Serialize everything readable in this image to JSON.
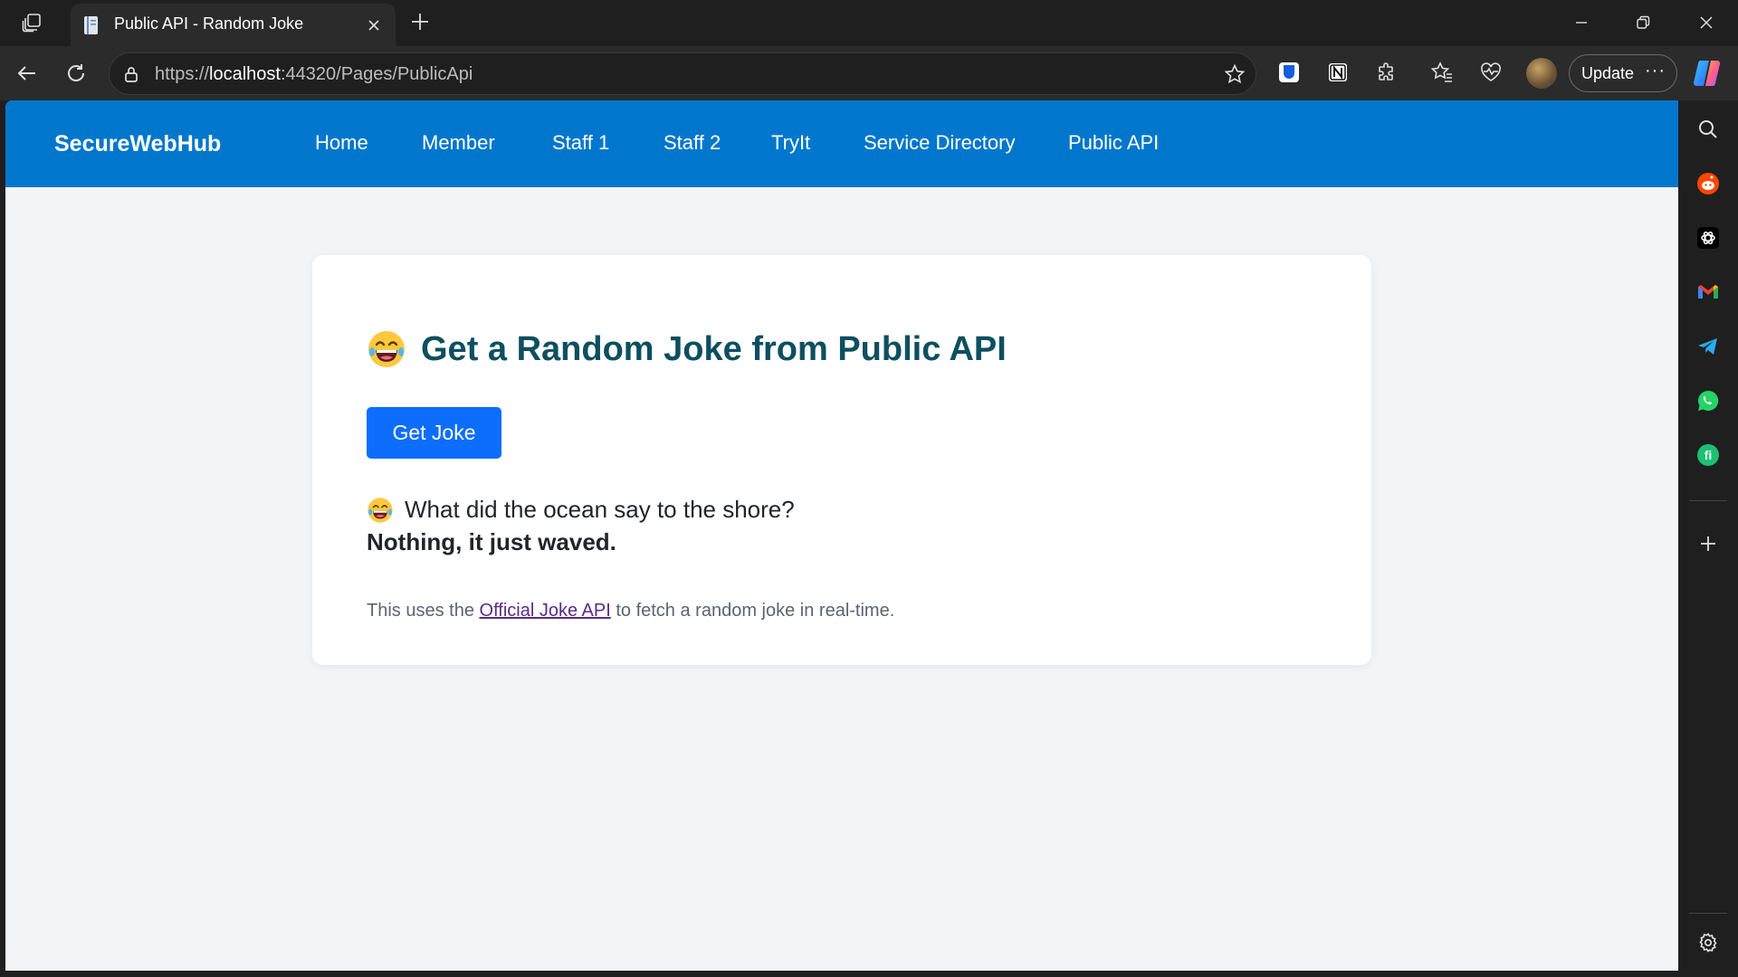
{
  "browser": {
    "tab": {
      "title": "Public API - Random Joke"
    },
    "address": {
      "scheme": "https://",
      "host": "localhost",
      "rest": ":44320/Pages/PublicApi"
    },
    "update_label": "Update",
    "more_label": "···"
  },
  "navbar": {
    "brand": "SecureWebHub",
    "links": [
      "Home",
      "Member",
      "Staff 1",
      "Staff 2",
      "TryIt",
      "Service Directory",
      "Public API"
    ]
  },
  "card": {
    "heading": "Get a Random Joke from Public API",
    "button_label": "Get Joke",
    "joke_setup": "What did the ocean say to the shore?",
    "joke_punchline": "Nothing, it just waved.",
    "footnote_before": "This uses the ",
    "footnote_link": "Official Joke API",
    "footnote_after": " to fetch a random joke in real-time."
  },
  "colors": {
    "navbar": "#0077cc",
    "heading": "#0d4f60",
    "button": "#0d6efd",
    "page_bg": "#f3f4f6"
  },
  "icons": {
    "sidebar": [
      "search-icon",
      "reddit-icon",
      "chatgpt-icon",
      "gmail-icon",
      "telegram-icon",
      "whatsapp-icon",
      "fiverr-icon",
      "add-icon",
      "settings-icon"
    ]
  }
}
